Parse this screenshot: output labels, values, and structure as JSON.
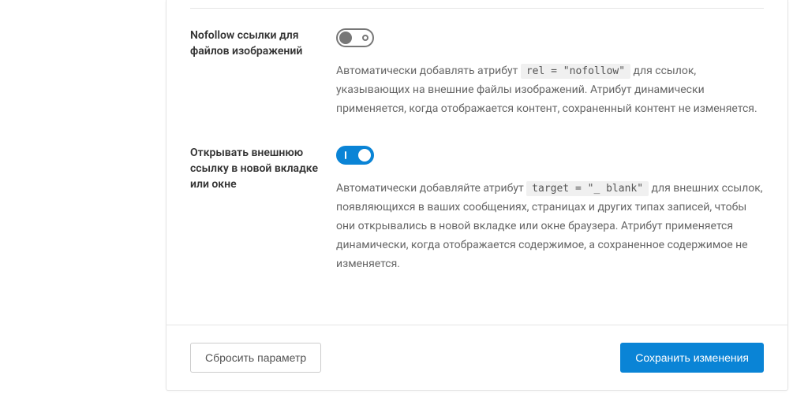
{
  "settings": [
    {
      "label": "Nofollow ссылки для файлов изображений",
      "enabled": false,
      "desc_before": "Автоматически добавлять атрибут ",
      "code": "rel = \"nofollow\"",
      "desc_after": " для ссылок, указывающих на внешние файлы изображений. Атрибут динамически применяется, когда отображается контент, сохраненный контент не изменяется."
    },
    {
      "label": "Открывать внешнюю ссылку в новой вкладке или окне",
      "enabled": true,
      "desc_before": "Автоматически добавляйте атрибут ",
      "code": "target = \"_ blank\"",
      "desc_after": " для внешних ссылок, появляющихся в ваших сообщениях, страницах и других типах записей, чтобы они открывались в новой вкладке или окне браузера. Атрибут применяется динамически, когда отображается содержимое, а сохраненное содержимое не изменяется."
    }
  ],
  "footer": {
    "reset": "Сбросить параметр",
    "save": "Сохранить изменения"
  }
}
